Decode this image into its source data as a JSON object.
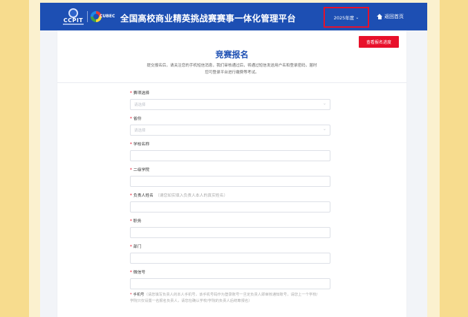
{
  "header": {
    "logo_ccpit_text": "CCPIT",
    "logo_cubec_text": "CUBEC",
    "title": "全国高校商业精英挑战赛赛事一体化管理平台",
    "year_select": "2025年度",
    "home_link": "返回首页"
  },
  "page": {
    "view_button": "查看报名进度",
    "title": "竞赛报名",
    "intro_line1": "提交报名后，请关注您的手机短信消息，我们审核通过后，将通过短信发送用户名和登录密码，届时",
    "intro_line2": "您可登录平台进行缴费等考试。"
  },
  "form": {
    "fields": [
      {
        "label": "赛项选择",
        "hint": "",
        "type": "select",
        "placeholder": "请选择"
      },
      {
        "label": "省份",
        "hint": "",
        "type": "select",
        "placeholder": "请选择"
      },
      {
        "label": "学校名称",
        "hint": "",
        "type": "input",
        "placeholder": ""
      },
      {
        "label": "二级学院",
        "hint": "",
        "type": "input",
        "placeholder": ""
      },
      {
        "label": "负责人姓名",
        "hint": "（请您如实填入负责人本人的真实姓名）",
        "type": "input",
        "placeholder": ""
      },
      {
        "label": "职务",
        "hint": "",
        "type": "input",
        "placeholder": ""
      },
      {
        "label": "部门",
        "hint": "",
        "type": "input",
        "placeholder": ""
      },
      {
        "label": "微信号",
        "hint": "",
        "type": "input",
        "placeholder": ""
      }
    ],
    "phone_label": "手机号",
    "phone_hint_line1": "（请您填写负责人的本人手机号，该手机号码作为登录账号一旦定负责人即审核通知账号，请您上一个学校/",
    "phone_hint_line2": "学院只仅设置一名报名负责人，请您在确认学校/学院的负责人后统筹报名）"
  }
}
